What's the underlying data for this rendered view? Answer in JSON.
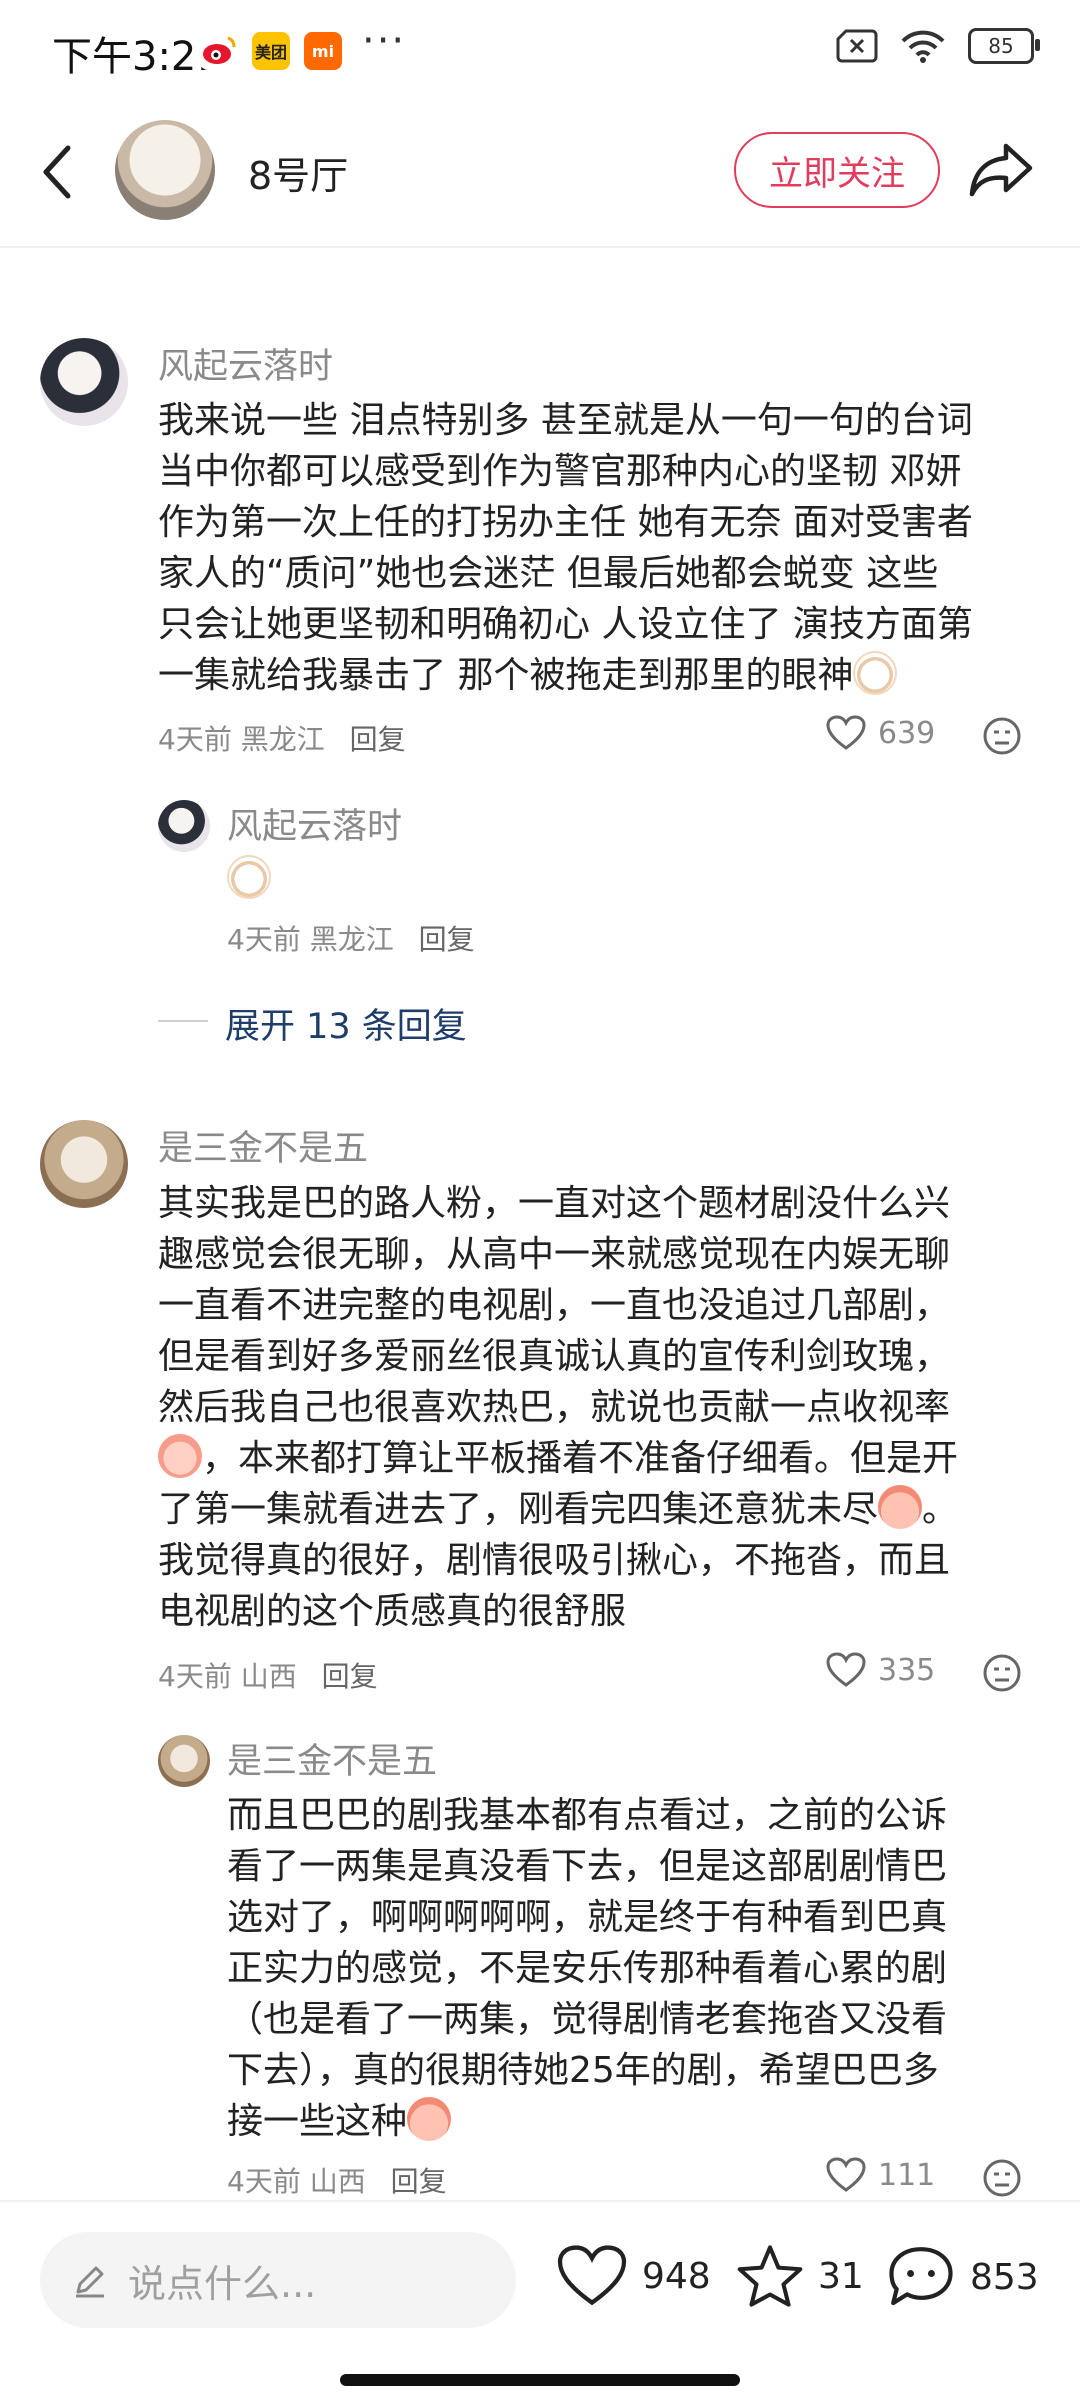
{
  "status_bar": {
    "time": "下午3:21",
    "apps": [
      {
        "name": "weibo-icon",
        "label": "",
        "color": "#e6162d"
      },
      {
        "name": "meituan-icon",
        "label": "美团",
        "color": "#ffc300"
      },
      {
        "name": "xiaomi-icon",
        "label": "mi",
        "color": "#ff6900"
      }
    ],
    "more": "···",
    "battery": "85"
  },
  "header": {
    "name": "8号厅",
    "follow_label": "立即关注"
  },
  "comments": [
    {
      "user": "风起云落时",
      "text": "我来说一些 泪点特别多 甚至就是从一句一句的台词当中你都可以感受到作为警官那种内心的坚韧 邓妍作为第一次上任的打拐办主任 她有无奈 面对受害者家人的“质问”她也会迷茫 但最后她都会蜕变 这些只会让她更坚韧和明确初心 人设立住了 演技方面第一集就给我暴击了 那个被拖走到那里的眼神",
      "time": "4天前",
      "location": "黑龙江",
      "reply_label": "回复",
      "likes": "639",
      "reply": {
        "user": "风起云落时",
        "time": "4天前",
        "location": "黑龙江",
        "reply_label": "回复"
      },
      "expand_label": "展开 13 条回复"
    },
    {
      "user": "是三金不是五",
      "text_lines": [
        "其实我是巴的路人粉，一直对这个题材剧没什么兴",
        "趣感觉会很无聊，从高中一来就感觉现在内娱无聊",
        "一直看不进完整的电视剧，一直也没追过几部剧，",
        "但是看到好多爱丽丝很真诚认真的宣传利剑玫瑰，",
        "然后我自己也很喜欢热巴，就说也贡献一点收视率",
        "，本来都打算让平板播着不准备仔细看。但是开",
        "了第一集就看进去了，刚看完四集还意犹未尽",
        "。",
        "我觉得真的很好，剧情很吸引揪心，不拖沓，而且",
        "电视剧的这个质感真的很舒服"
      ],
      "time": "4天前",
      "location": "山西",
      "reply_label": "回复",
      "likes": "335",
      "reply": {
        "user": "是三金不是五",
        "text_lines": [
          "而且巴巴的剧我基本都有点看过，之前的公诉",
          "看了一两集是真没看下去，但是这部剧剧情巴",
          "选对了，啊啊啊啊啊，就是终于有种看到巴真",
          "正实力的感觉，不是安乐传那种看着心累的剧",
          "（也是看了一两集，觉得剧情老套拖沓又没看",
          "下去），真的很期待她25年的剧，希望巴巴多",
          "接一些这种"
        ],
        "time": "4天前",
        "location": "山西",
        "reply_label": "回复",
        "likes": "111"
      }
    }
  ],
  "first_comment_lines": [
    "我来说一些 泪点特别多 甚至就是从一句一句的台词",
    "当中你都可以感受到作为警官那种内心的坚韧 邓妍",
    "作为第一次上任的打拐办主任 她有无奈 面对受害者",
    "家人的“质问”她也会迷茫 但最后她都会蜕变 这些",
    "只会让她更坚韧和明确初心 人设立住了 演技方面第",
    "一集就给我暴击了 那个被拖走到那里的眼神"
  ],
  "bottom_bar": {
    "placeholder": "说点什么...",
    "likes": "948",
    "stars": "31",
    "comments": "853"
  },
  "colors": {
    "accent": "#e33b5b",
    "link": "#1e3d6b",
    "muted": "#8a8a8a"
  }
}
